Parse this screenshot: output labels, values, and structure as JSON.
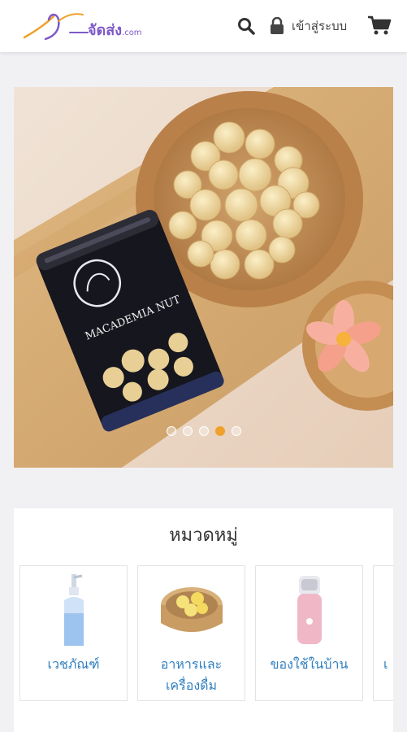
{
  "header": {
    "logo_text": "จัดส่ง",
    "logo_suffix": ".com",
    "login_label": "เข้าสู่ระบบ",
    "icons": [
      "search-icon",
      "lock-icon",
      "cart-icon"
    ]
  },
  "banner": {
    "product_label": "MACADEMIA NUT",
    "slides": 5,
    "active_slide": 4
  },
  "categories": {
    "title": "หมวดหมู่",
    "items": [
      {
        "label": "เวชภัณฑ์"
      },
      {
        "label": "อาหารและ",
        "label2": "เครื่องดื่ม"
      },
      {
        "label": "ของใช้ในบ้าน"
      },
      {
        "label": "เ"
      }
    ]
  },
  "colors": {
    "brand": "#7d59c8",
    "link": "#2f7fbf",
    "active_dot": "#f0a12c"
  }
}
